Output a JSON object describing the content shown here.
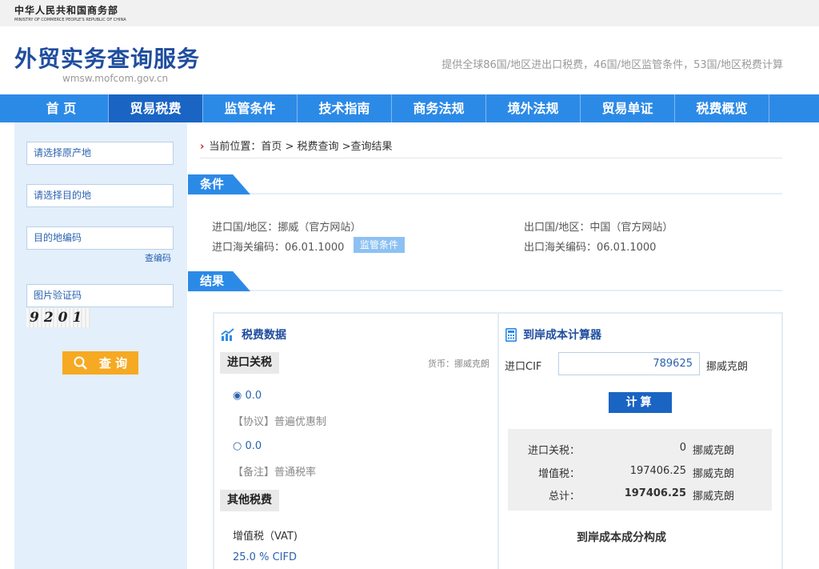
{
  "ministry": {
    "cn": "中华人民共和国商务部",
    "en": "MINISTRY OF COMMERCE PEOPLE'S REPUBLIC OF CHINA"
  },
  "site": {
    "title": "外贸实务查询服务",
    "domain": "wmsw.mofcom.gov.cn",
    "desc": "提供全球86国/地区进出口税费，46国/地区监管条件，53国/地区税费计算"
  },
  "nav": [
    "首 页",
    "贸易税费",
    "监管条件",
    "技术指南",
    "商务法规",
    "境外法规",
    "贸易单证",
    "税费概览"
  ],
  "sidebar": {
    "origin_placeholder": "请选择原产地",
    "dest_placeholder": "请选择目的地",
    "code_placeholder": "目的地编码",
    "lookup_link": "查编码",
    "captcha_placeholder": "图片验证码",
    "captcha_text": "9201",
    "query_label": "查 询"
  },
  "breadcrumb": "当前位置：首页 > 税费查询 >查询结果",
  "conditions": {
    "title": "条件",
    "import_country": "进口国/地区：挪威（官方网站）",
    "import_code": "进口海关编码：06.01.1000",
    "regulation_btn": "监管条件",
    "export_country": "出口国/地区：中国（官方网站）",
    "export_code": "出口海关编码：06.01.1000"
  },
  "results": {
    "title": "结果",
    "tax_title": "税费数据",
    "import_duty": "进口关税",
    "currency": "货币：挪威克朗",
    "rate1": "◉ 0.0",
    "rate1_note": "【协议】普遍优惠制",
    "rate2": "○ 0.0",
    "rate2_note": "【备注】普通税率",
    "other_tax": "其他税费",
    "vat_label": "增值税（VAT)",
    "vat_rate": "25.0 % CIFD"
  },
  "calculator": {
    "title": "到岸成本计算器",
    "cif_label": "进口CIF",
    "cif_value": "789625",
    "unit": "挪威克朗",
    "calc_btn": "计算",
    "rows": [
      {
        "label": "进口关税：",
        "value": "0",
        "unit": "挪威克朗"
      },
      {
        "label": "增值税：",
        "value": "197406.25",
        "unit": "挪威克朗"
      },
      {
        "label": "总计：",
        "value": "197406.25",
        "unit": "挪威克朗"
      }
    ],
    "composition_title": "到岸成本成分构成"
  },
  "colors": {
    "nav": "#2c8ae7",
    "nav_active": "#1a64c3",
    "brand": "#1f4d9e",
    "accent": "#f6a922"
  }
}
